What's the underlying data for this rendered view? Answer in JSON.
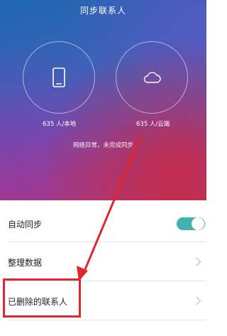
{
  "header": {
    "title": "同步联系人"
  },
  "sync": {
    "local_caption": "635 人/本地",
    "cloud_caption": "635 人/云端",
    "status_text": "网络异常，未完成同步"
  },
  "settings": {
    "items": [
      {
        "label": "自动同步",
        "control": "toggle",
        "enabled": true
      },
      {
        "label": "整理数据",
        "control": "chevron"
      },
      {
        "label": "已删除的联系人",
        "control": "chevron"
      }
    ]
  },
  "colors": {
    "toggle_on": "#3fb3b0",
    "annotation_red": "#e2262e"
  },
  "icons": {
    "local": "phone-icon",
    "cloud": "cloud-icon",
    "chevron": "chevron-right-icon"
  }
}
